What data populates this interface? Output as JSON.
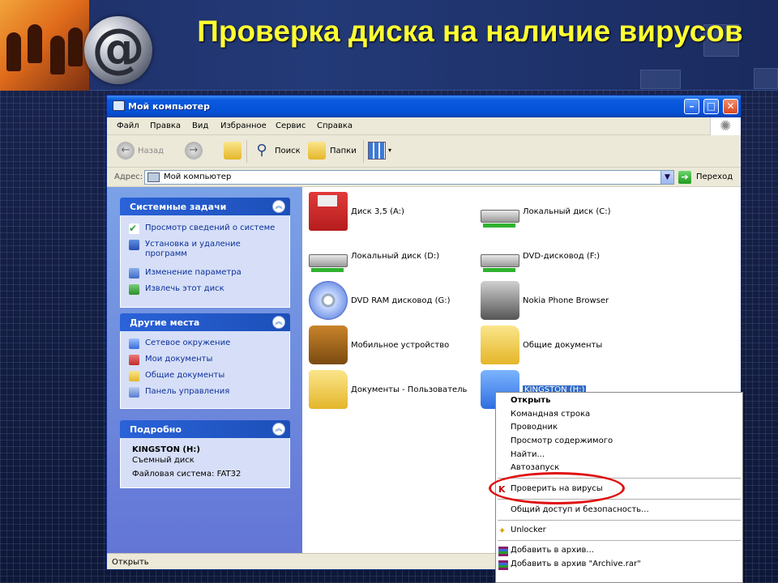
{
  "slide": {
    "title": "Проверка диска на наличие вирусов"
  },
  "window": {
    "title": "Мой компьютер",
    "menu": [
      "Файл",
      "Правка",
      "Вид",
      "Избранное",
      "Сервис",
      "Справка"
    ],
    "toolbar": {
      "back_label": "Назад",
      "search_label": "Поиск",
      "folders_label": "Папки"
    },
    "address": {
      "label": "Адрес:",
      "value": "Мой компьютер",
      "go_label": "Переход"
    },
    "status_text": "Открыть"
  },
  "taskpane": {
    "system_tasks": {
      "title": "Системные задачи",
      "items": [
        {
          "label": "Просмотр сведений о системе",
          "icon": "check-icon"
        },
        {
          "label": "Установка и удаление программ",
          "icon": "programs-icon"
        },
        {
          "label": "Изменение параметра",
          "icon": "control-icon"
        },
        {
          "label": "Извлечь этот диск",
          "icon": "eject-icon"
        }
      ]
    },
    "other_places": {
      "title": "Другие места",
      "items": [
        {
          "label": "Сетевое окружение",
          "icon": "network-icon"
        },
        {
          "label": "Мои документы",
          "icon": "documents-icon"
        },
        {
          "label": "Общие документы",
          "icon": "shared-folder-icon"
        },
        {
          "label": "Панель управления",
          "icon": "control-panel-icon"
        }
      ]
    },
    "details": {
      "title": "Подробно",
      "name": "KINGSTON (H:)",
      "type": "Съемный диск",
      "fs": "Файловая система: FAT32"
    }
  },
  "drives": [
    {
      "label": "Диск 3,5 (A:)",
      "icon": "floppy-icon"
    },
    {
      "label": "Локальный диск (C:)",
      "icon": "hard-drive-icon"
    },
    {
      "label": "Локальный диск (D:)",
      "icon": "hard-drive-icon"
    },
    {
      "label": "DVD-дисковод (F:)",
      "icon": "dvd-drive-icon"
    },
    {
      "label": "DVD RAM дисковод (G:)",
      "icon": "dvd-disc-icon"
    },
    {
      "label": "Nokia Phone Browser",
      "icon": "phone-browser-icon"
    },
    {
      "label": "Мобильное устройство",
      "icon": "mobile-device-icon"
    },
    {
      "label": "Общие документы",
      "icon": "folder-icon"
    },
    {
      "label": "Документы - Пользователь",
      "icon": "folder-icon"
    },
    {
      "label": "KINGSTON (H:)",
      "icon": "usb-drive-icon"
    }
  ],
  "context_menu": {
    "items": [
      "Открыть",
      "Командная строка",
      "Проводник",
      "Просмотр содержимого",
      "Найти...",
      "Автозапуск",
      "Проверить на вирусы",
      "Общий доступ и безопасность...",
      "Unlocker",
      "Добавить в архив...",
      "Добавить в архив \"Archive.rar\""
    ]
  },
  "colors": {
    "title_yellow": "#ffff33",
    "xp_blue": "#0350d4",
    "highlight_red": "#e01010",
    "selection_blue": "#316ac5"
  }
}
